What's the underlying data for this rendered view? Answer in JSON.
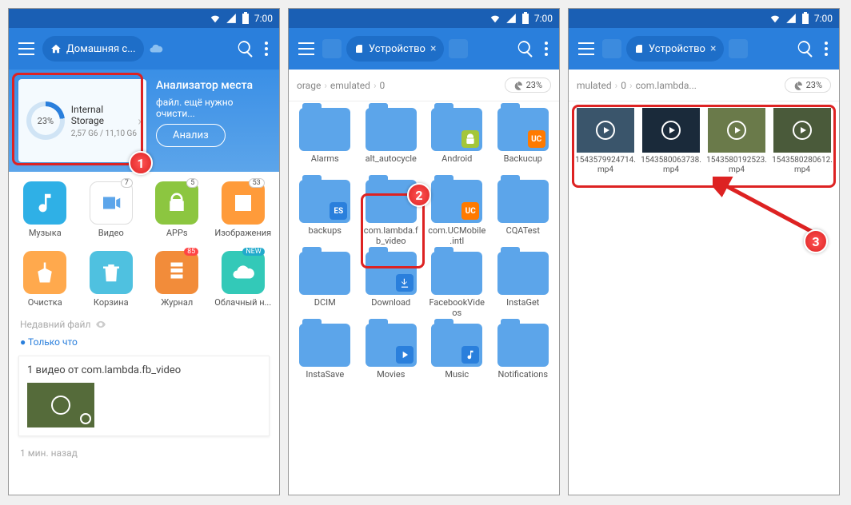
{
  "status": {
    "time": "7:00"
  },
  "screen1": {
    "tab_label": "Домашняя с...",
    "storage": {
      "percent": "23%",
      "title": "Internal Storage",
      "sub": "2,57 G6 / 11,10 G6"
    },
    "analyzer": {
      "title": "Анализатор места",
      "sub": "файл. ещё нужно очисти...",
      "btn": "Анализ"
    },
    "row1": [
      {
        "label": "Музыка",
        "badge": "",
        "color": "#2fb0e6",
        "icon": "music"
      },
      {
        "label": "Видео",
        "badge": "7",
        "color": "#fff",
        "icon": "video"
      },
      {
        "label": "APPs",
        "badge": "5",
        "color": "#8cc640",
        "icon": "app"
      },
      {
        "label": "Изображения",
        "badge": "53",
        "color": "#ff9b3a",
        "icon": "image"
      }
    ],
    "row2": [
      {
        "label": "Очистка",
        "badge": "",
        "color": "#ffa94d",
        "icon": "clean"
      },
      {
        "label": "Корзина",
        "badge": "",
        "color": "#4fc1e0",
        "icon": "trash"
      },
      {
        "label": "Журнал",
        "badge": "85",
        "badgeClass": "red",
        "color": "#f28c3a",
        "icon": "log"
      },
      {
        "label": "Облачный н...",
        "badge": "NEW",
        "badgeClass": "new",
        "color": "#33c9b8",
        "icon": "cloud"
      }
    ],
    "recent_hdr": "Недавний файл",
    "just_now": "Только что",
    "recent_item": "1 видео от com.lambda.fb_video",
    "older": "1 мин. назад"
  },
  "screen2": {
    "tab_label": "Устройство",
    "crumbs": [
      "orage",
      "emulated",
      "0"
    ],
    "percent": "23%",
    "folders": [
      {
        "label": "Alarms",
        "mini": ""
      },
      {
        "label": "alt_autocycle",
        "mini": ""
      },
      {
        "label": "Android",
        "mini": "android",
        "mc": "#a4c639"
      },
      {
        "label": "Backucup",
        "mini": "uc",
        "mc": "#ff7a00"
      },
      {
        "label": "backups",
        "mini": "es",
        "mc": "#2a7fdc"
      },
      {
        "label": "com.lambda.fb_video",
        "badge": "2"
      },
      {
        "label": "com.UCMobile.intl",
        "mini": "uc",
        "mc": "#ff7a00"
      },
      {
        "label": "CQATest",
        "mini": ""
      },
      {
        "label": "DCIM",
        "mini": ""
      },
      {
        "label": "Download",
        "mini": "dl"
      },
      {
        "label": "FacebookVideos",
        "mini": ""
      },
      {
        "label": "InstaGet",
        "mini": ""
      },
      {
        "label": "InstaSave",
        "mini": ""
      },
      {
        "label": "Movies",
        "mini": "mov"
      },
      {
        "label": "Music",
        "mini": "mus"
      },
      {
        "label": "Notifications",
        "mini": ""
      }
    ]
  },
  "screen3": {
    "tab_label": "Устройство",
    "crumbs": [
      "mulated",
      "0",
      "com.lambda..."
    ],
    "percent": "23%",
    "videos": [
      {
        "label": "1543579924714.mp4",
        "bg": "#3a556b"
      },
      {
        "label": "1543580063738.mp4",
        "bg": "#1a2a3a"
      },
      {
        "label": "1543580192523.mp4",
        "bg": "#6a7a4a"
      },
      {
        "label": "1543580280612.mp4",
        "bg": "#4a5a3a"
      }
    ]
  },
  "annotations": {
    "n1": "1",
    "n2": "2",
    "n3": "3"
  }
}
